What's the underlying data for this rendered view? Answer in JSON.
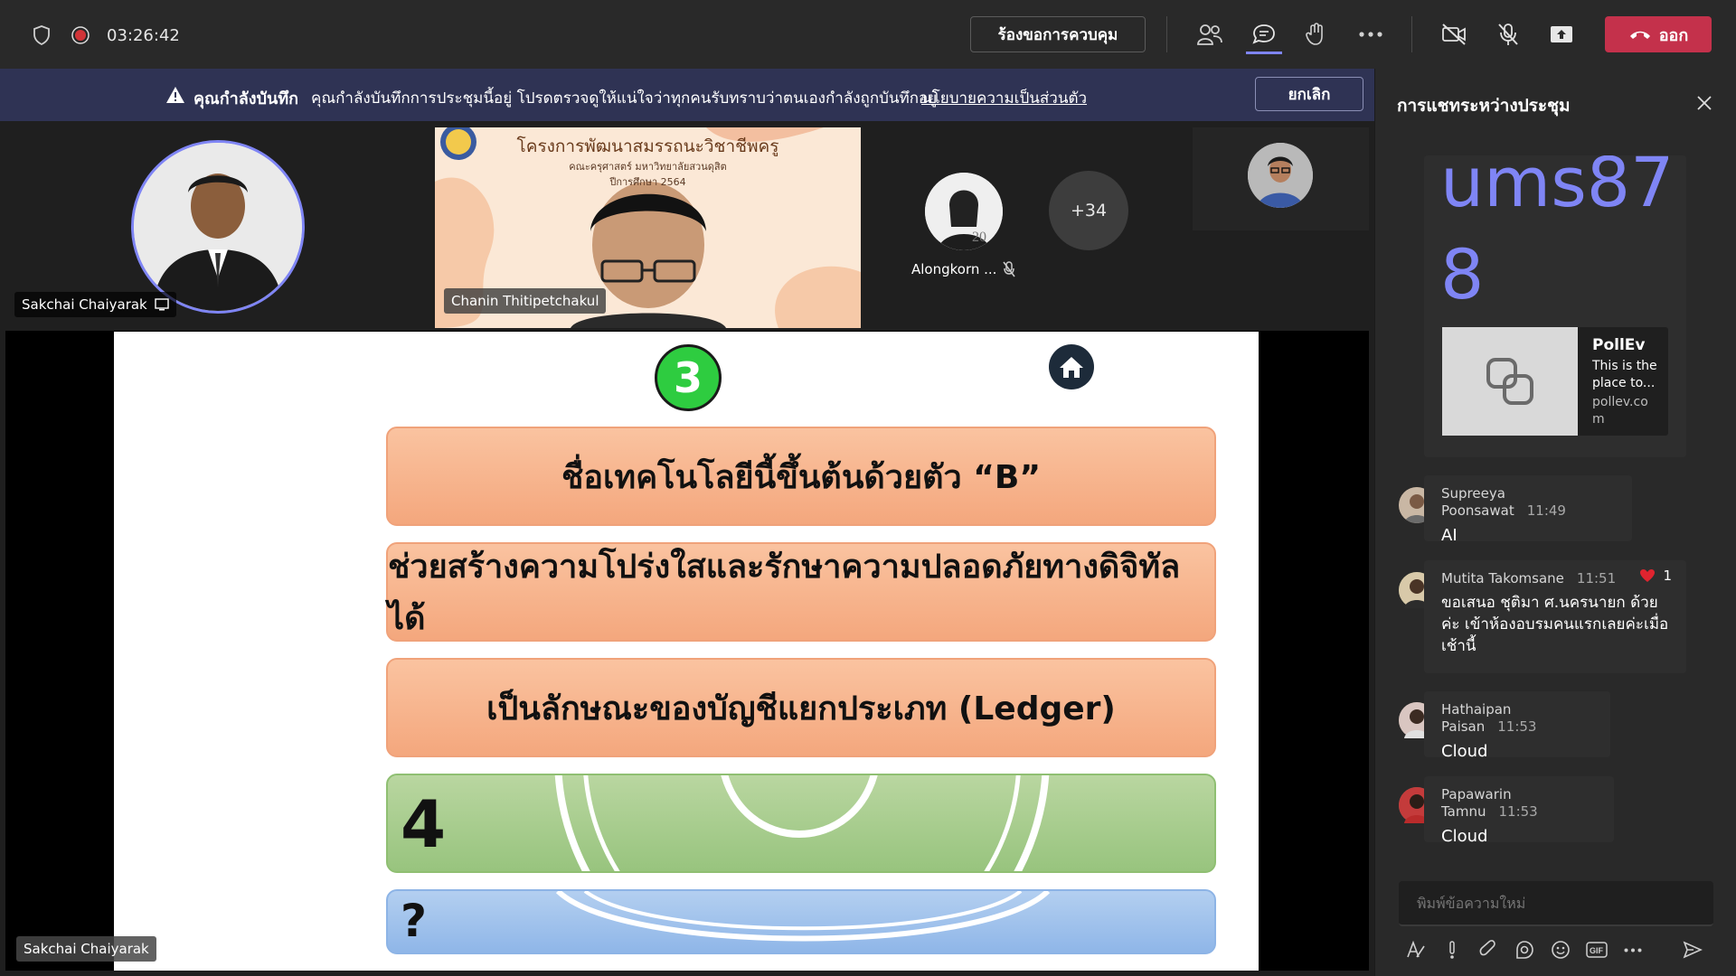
{
  "topbar": {
    "timer": "03:26:42",
    "request_control_label": "ร้องขอการควบคุม",
    "leave_label": "ออก"
  },
  "recording_banner": {
    "title": "คุณกำลังบันทึก",
    "message": "คุณกำลังบันทึกการประชุมนี้อยู่ โปรดตรวจดูให้แน่ใจว่าทุกคนรับทราบว่าตนเองกำลังถูกบันทึกอยู่",
    "link": "นโยบายความเป็นส่วนตัว",
    "cancel_label": "ยกเลิก"
  },
  "participants": {
    "presenter_name": "Sakchai Chaiyarak",
    "video_name": "Chanin Thitipetchakul",
    "video_banner_line1": "โครงการพัฒนาสมรรถนะวิชาชีพครู",
    "video_banner_line2": "คณะครุศาสตร์ มหาวิทยาลัยสวนดุสิต",
    "video_banner_line3": "ปีการศึกษา 2564",
    "small_tile_name": "Alongkorn ...",
    "overflow_count": "+34",
    "screen_share_name": "Sakchai Chaiyarak"
  },
  "slide": {
    "number": "3",
    "clue1": "ชื่อเทคโนโลยีนี้ขึ้นต้นด้วยตัว “B”",
    "clue2": "ช่วยสร้างความโปร่งใสและรักษาความปลอดภัยทางดิจิทัลได้",
    "clue3": "เป็นลักษณะของบัญชีแยกประเภท (Ledger)",
    "answer_length": "4",
    "answer": "?"
  },
  "chat": {
    "title": "การแชทระหว่างประชุม",
    "partial_text_line1": "ums87",
    "partial_text_line2": "8",
    "link_card": {
      "title": "PollEv",
      "description": "This is the place to...",
      "domain": "pollev.co m"
    },
    "messages": [
      {
        "name": "Supreeya Poonsawat",
        "time": "11:49",
        "body": "AI"
      },
      {
        "name": "Mutita Takomsane",
        "time": "11:51",
        "body": "ขอเสนอ ชุติมา ศ.นครนายก ด้วยค่ะ เข้าห้องอบรมคนแรกเลยค่ะเมื่อเช้านี้",
        "reaction_count": "1"
      },
      {
        "name": "Hathaipan Paisan",
        "time": "11:53",
        "body": "Cloud"
      },
      {
        "name": "Papawarin Tamnu",
        "time": "11:53",
        "body": "Cloud"
      }
    ],
    "compose_placeholder": "พิมพ์ข้อความใหม่"
  },
  "colors": {
    "leave": "#c4314b",
    "accent": "#7f85f5",
    "banner": "#2f3354",
    "slide_number": "#2ecc40"
  }
}
